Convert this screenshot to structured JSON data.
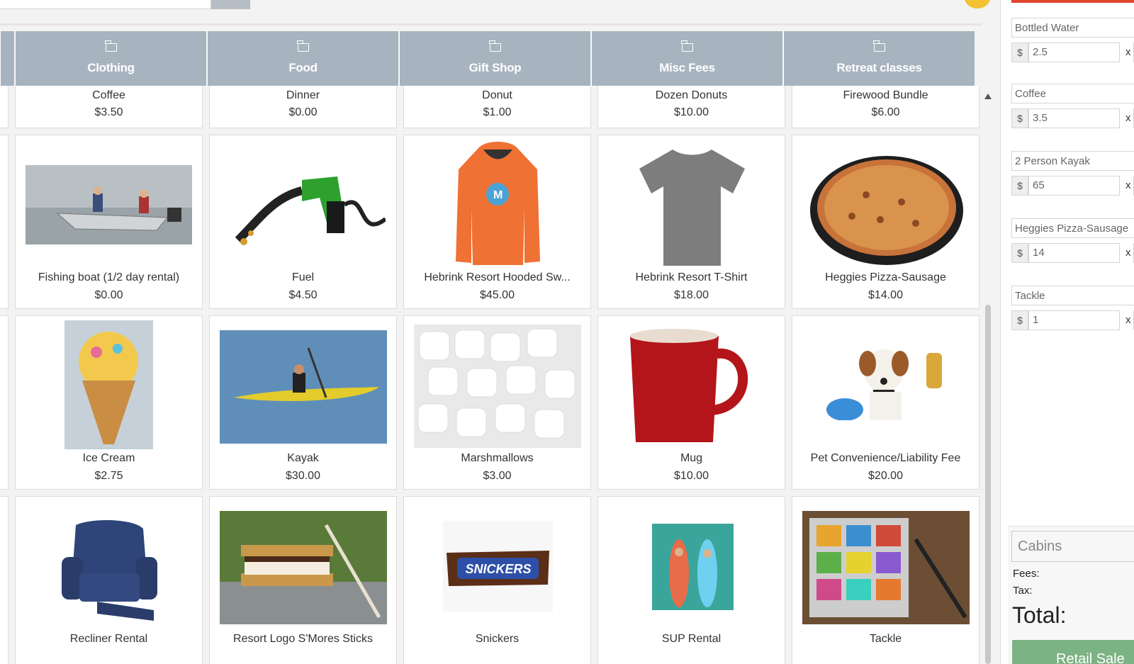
{
  "categories": [
    {
      "label": ""
    },
    {
      "label": "Clothing"
    },
    {
      "label": "Food"
    },
    {
      "label": "Gift Shop"
    },
    {
      "label": "Misc Fees"
    },
    {
      "label": "Retreat classes"
    }
  ],
  "products": [
    {
      "name": "Coffee",
      "price": "$3.50"
    },
    {
      "name": "Dinner",
      "price": "$0.00"
    },
    {
      "name": "Donut",
      "price": "$1.00"
    },
    {
      "name": "Dozen Donuts",
      "price": "$10.00"
    },
    {
      "name": "Firewood Bundle",
      "price": "$6.00"
    },
    {
      "name": "Fishing boat (1/2 day rental)",
      "price": "$0.00",
      "icon": "boat-image"
    },
    {
      "name": "Fuel",
      "price": "$4.50",
      "icon": "fuel-nozzle-image"
    },
    {
      "name": "Hebrink Resort Hooded Sw...",
      "price": "$45.00",
      "icon": "orange-hoodie-image"
    },
    {
      "name": "Hebrink Resort T-Shirt",
      "price": "$18.00",
      "icon": "gray-tshirt-image"
    },
    {
      "name": "Heggies Pizza-Sausage",
      "price": "$14.00",
      "icon": "pizza-image"
    },
    {
      "name": "Ice Cream",
      "price": "$2.75",
      "icon": "ice-cream-cone-image"
    },
    {
      "name": "Kayak",
      "price": "$30.00",
      "icon": "kayak-image"
    },
    {
      "name": "Marshmallows",
      "price": "$3.00",
      "icon": "marshmallows-image"
    },
    {
      "name": "Mug",
      "price": "$10.00",
      "icon": "red-mug-image"
    },
    {
      "name": "Pet Convenience/Liability Fee",
      "price": "$20.00",
      "icon": "dog-coins-image"
    },
    {
      "name": "Recliner Rental",
      "price": "",
      "icon": "recliner-image"
    },
    {
      "name": "Resort Logo S'Mores Sticks",
      "price": "",
      "icon": "smores-image"
    },
    {
      "name": "Snickers",
      "price": "",
      "icon": "snickers-image",
      "logo_text": "SNICKERS"
    },
    {
      "name": "SUP Rental",
      "price": "",
      "icon": "paddleboard-image"
    },
    {
      "name": "Tackle",
      "price": "",
      "icon": "tackle-box-image"
    }
  ],
  "cart": {
    "items": [
      {
        "name": "Bottled Water",
        "currency": "$",
        "price": "2.5",
        "times": "x"
      },
      {
        "name": "Coffee",
        "currency": "$",
        "price": "3.5",
        "times": "x"
      },
      {
        "name": "2 Person Kayak",
        "currency": "$",
        "price": "65",
        "times": "x"
      },
      {
        "name": "Heggies Pizza-Sausage",
        "currency": "$",
        "price": "14",
        "times": "x"
      },
      {
        "name": "Tackle",
        "currency": "$",
        "price": "1",
        "times": "x"
      }
    ],
    "customer_select": "Cabins",
    "fees_label": "Fees:",
    "tax_label": "Tax:",
    "total_label": "Total:",
    "checkout_button": "Retail Sale"
  },
  "colors": {
    "category_bg": "#a7b4bf",
    "accent_red": "#e0442d",
    "checkout_green": "#7cb384",
    "coin_yellow": "#f1c232"
  }
}
